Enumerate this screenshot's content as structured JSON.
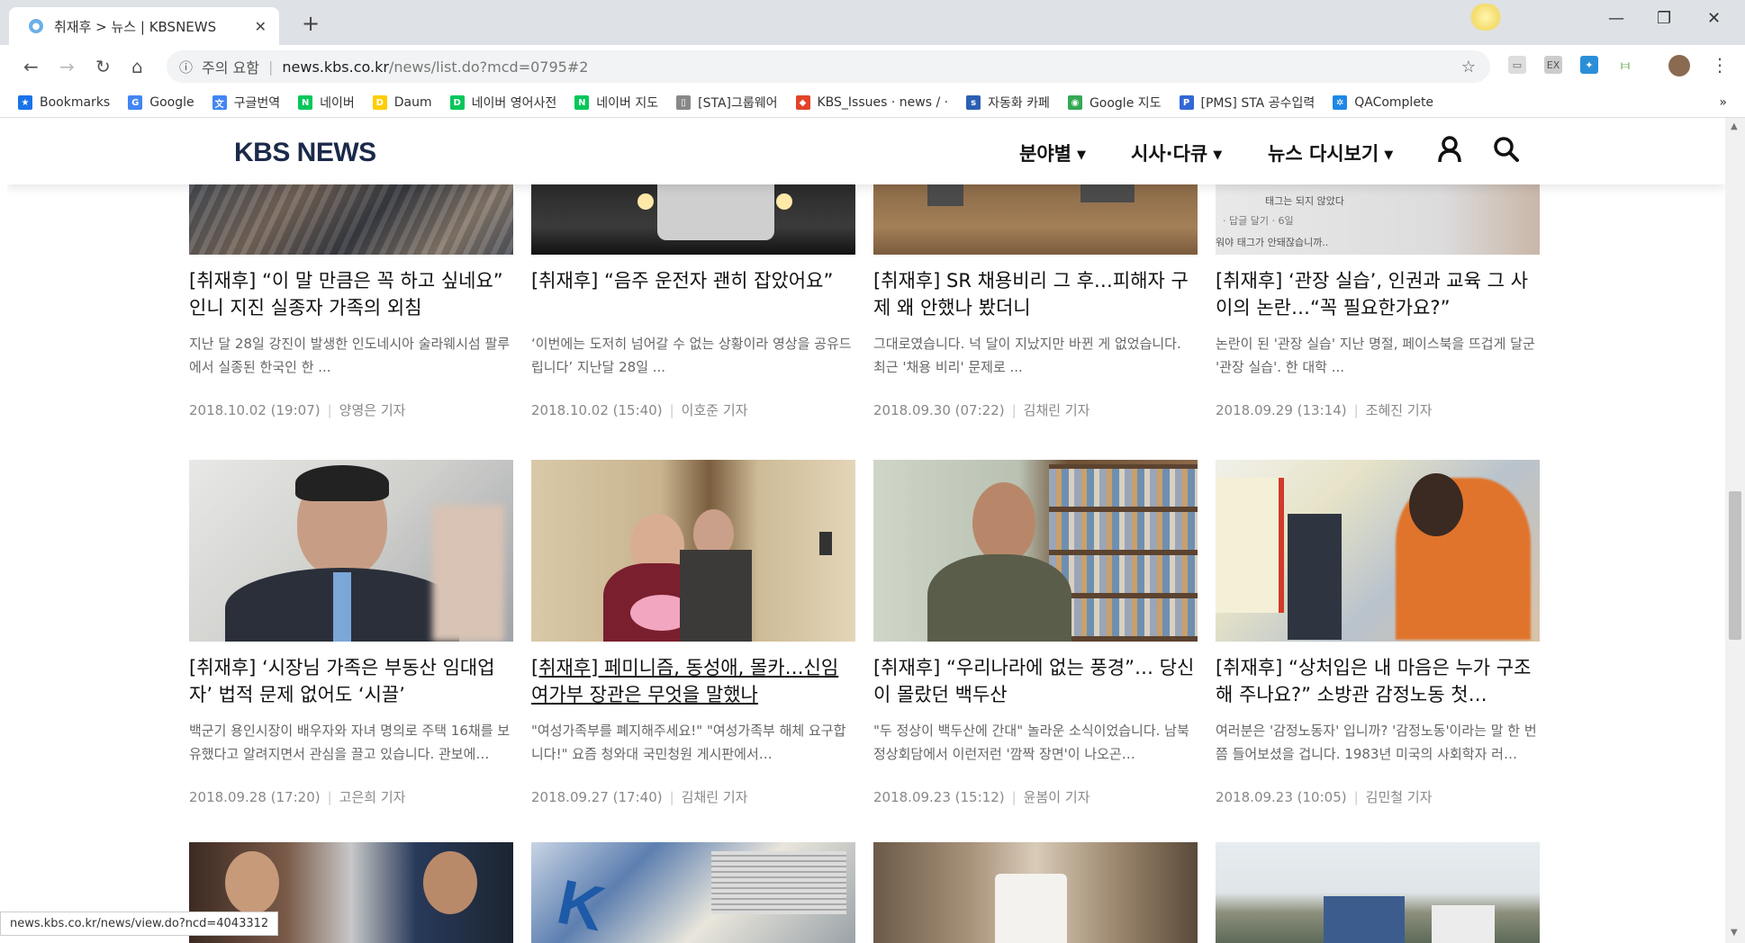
{
  "browser": {
    "tab_title": "취재후 > 뉴스 | KBSNEWS",
    "address": {
      "security_label": "주의 요함",
      "host": "news.kbs.co.kr",
      "path": "/news/list.do?mcd=0795#2"
    },
    "bookmarks": [
      {
        "label": "Bookmarks",
        "icon": "star-icon",
        "color": "#1a73e8"
      },
      {
        "label": "Google",
        "icon": "google-icon",
        "color": "#4285f4"
      },
      {
        "label": "구글번역",
        "icon": "translate-icon",
        "color": "#4285f4"
      },
      {
        "label": "네이버",
        "icon": "naver-icon",
        "color": "#03c75a"
      },
      {
        "label": "Daum",
        "icon": "daum-icon",
        "color": "#ffcd00"
      },
      {
        "label": "네이버 영어사전",
        "icon": "dict-icon",
        "color": "#03c75a"
      },
      {
        "label": "네이버 지도",
        "icon": "naver-icon",
        "color": "#03c75a"
      },
      {
        "label": "[STA]그룹웨어",
        "icon": "page-icon",
        "color": "#888888"
      },
      {
        "label": "KBS_Issues · news / ·",
        "icon": "gitlab-icon",
        "color": "#e24329"
      },
      {
        "label": "자동화 카페",
        "icon": "cafe-icon",
        "color": "#2b5fb3"
      },
      {
        "label": "Google 지도",
        "icon": "maps-icon",
        "color": "#34a853"
      },
      {
        "label": "[PMS] STA 공수입력",
        "icon": "pms-icon",
        "color": "#3367d6"
      },
      {
        "label": "QAComplete",
        "icon": "qa-icon",
        "color": "#1e88e5"
      }
    ],
    "status_url": "news.kbs.co.kr/news/view.do?ncd=4043312"
  },
  "site": {
    "logo": "KBS NEWS",
    "menu": [
      {
        "label": "분야별"
      },
      {
        "label": "시사·다큐"
      },
      {
        "label": "뉴스 다시보기"
      }
    ]
  },
  "articles": [
    {
      "title": "[취재후] “이 말 만큼은 꼭 하고 싶네요” 인니 지진 실종자 가족의 외침",
      "summary": "지난 달 28일 강진이 발생한 인도네시아 술라웨시섬 팔루에서 실종된 한국인 한 ...",
      "date": "2018.10.02 (19:07)",
      "reporter": "양영은 기자"
    },
    {
      "title": "[취재후] “음주 운전자 괜히 잡았어요”",
      "summary": "‘이번에는 도저히 넘어갈 수 없는 상황이라 영상을 공유드립니다’ 지난달 28일 ...",
      "date": "2018.10.02 (15:40)",
      "reporter": "이호준 기자"
    },
    {
      "title": "[취재후] SR 채용비리 그 후…피해자 구제 왜 안했나 봤더니",
      "summary": "그대로였습니다. 넉 달이 지났지만 바뀐 게 없었습니다. 최근 '채용 비리' 문제로 ...",
      "date": "2018.09.30 (07:22)",
      "reporter": "김채린 기자"
    },
    {
      "title": "[취재후] ‘관장 실습’, 인권과 교육 그 사이의 논란…“꼭 필요한가요?”",
      "summary": "논란이 된 '관장 실습' 지난 명절, 페이스북을 뜨겁게 달군 '관장 실습'. 한 대학 ...",
      "date": "2018.09.29 (13:14)",
      "reporter": "조혜진 기자"
    },
    {
      "title": "[취재후] ‘시장님 가족은 부동산 임대업자’ 법적 문제 없어도 ‘시끌’",
      "summary": "백군기 용인시장이 배우자와 자녀 명의로 주택 16채를 보유했다고 알려지면서 관심을 끌고 있습니다. 관보에…",
      "date": "2018.09.28 (17:20)",
      "reporter": "고은희 기자"
    },
    {
      "title": "[취재후] 페미니즘, 동성애, 몰카…신임 여가부 장관은 무엇을 말했나",
      "summary": "\"여성가족부를 폐지해주세요!\" \"여성가족부 해체 요구합니다!\" 요즘 청와대 국민청원 게시판에서…",
      "date": "2018.09.27 (17:40)",
      "reporter": "김채린 기자"
    },
    {
      "title": "[취재후] “우리나라에 없는 풍경”… 당신이 몰랐던 백두산",
      "summary": "\"두 정상이 백두산에 간대\" 놀라운 소식이었습니다. 남북정상회담에서 이런저런 '깜짝 장면'이 나오곤…",
      "date": "2018.09.23 (15:12)",
      "reporter": "윤봄이 기자"
    },
    {
      "title": "[취재후] “상처입은 내 마음은 누가 구조해 주나요?” 소방관 감정노동 첫…",
      "summary": "여러분은 '감정노동자' 입니까? '감정노동'이라는 말 한 번쯤 들어보셨을 겁니다. 1983년 미국의 사회학자 러…",
      "date": "2018.09.23 (10:05)",
      "reporter": "김민철 기자"
    }
  ],
  "thumb_texts": {
    "tag1": "태그는 되지 않았다",
    "tag2": "· 답글 달기 · 6일",
    "tag3": "워야 태그가 안돼잖습니까.."
  }
}
